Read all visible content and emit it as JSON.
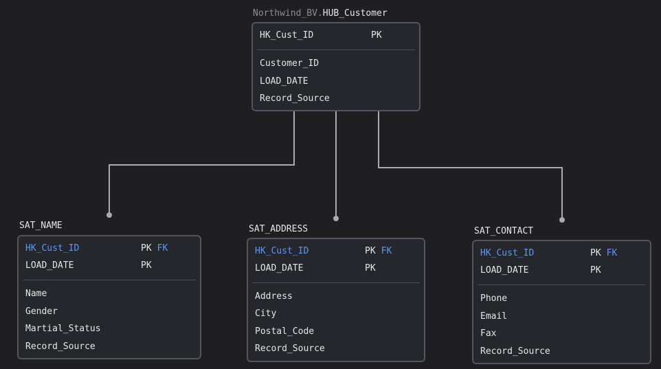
{
  "hub": {
    "schema": "Northwind_BV.",
    "name": "HUB_Customer",
    "keys": [
      {
        "name": "HK_Cust_ID",
        "pk": "PK",
        "fk": ""
      }
    ],
    "columns": [
      "Customer_ID",
      "LOAD_DATE",
      "Record_Source"
    ]
  },
  "sat_name": {
    "name": "SAT_NAME",
    "keys": [
      {
        "name": "HK_Cust_ID",
        "pk": "PK",
        "fk": "FK"
      },
      {
        "name": "LOAD_DATE",
        "pk": "PK",
        "fk": ""
      }
    ],
    "columns": [
      "Name",
      "Gender",
      "Martial_Status",
      "Record_Source"
    ]
  },
  "sat_address": {
    "name": "SAT_ADDRESS",
    "keys": [
      {
        "name": "HK_Cust_ID",
        "pk": "PK",
        "fk": "FK"
      },
      {
        "name": "LOAD_DATE",
        "pk": "PK",
        "fk": ""
      }
    ],
    "columns": [
      "Address",
      "City",
      "Postal_Code",
      "Record_Source"
    ]
  },
  "sat_contact": {
    "name": "SAT_CONTACT",
    "keys": [
      {
        "name": "HK_Cust_ID",
        "pk": "PK",
        "fk": "FK"
      },
      {
        "name": "LOAD_DATE",
        "pk": "PK",
        "fk": ""
      }
    ],
    "columns": [
      "Phone",
      "Email",
      "Fax",
      "Record_Source"
    ]
  },
  "colors": {
    "background": "#1f1f21",
    "table_fill": "#25272c",
    "table_border": "#51555d",
    "connector": "#a9abb0",
    "text": "#e6e6e6",
    "foreign_key": "#5e97f6",
    "schema_prefix": "#8b8e94"
  }
}
